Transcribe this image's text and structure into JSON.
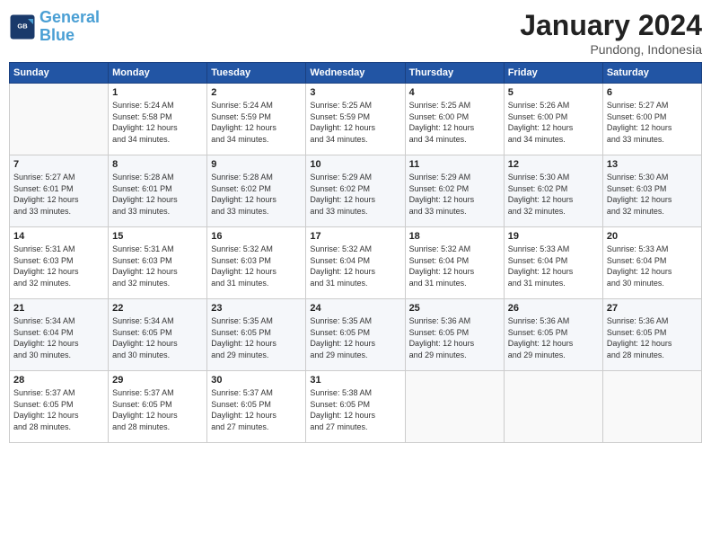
{
  "logo": {
    "text1": "General",
    "text2": "Blue"
  },
  "title": "January 2024",
  "location": "Pundong, Indonesia",
  "headers": [
    "Sunday",
    "Monday",
    "Tuesday",
    "Wednesday",
    "Thursday",
    "Friday",
    "Saturday"
  ],
  "weeks": [
    [
      {
        "day": "",
        "info": ""
      },
      {
        "day": "1",
        "info": "Sunrise: 5:24 AM\nSunset: 5:58 PM\nDaylight: 12 hours\nand 34 minutes."
      },
      {
        "day": "2",
        "info": "Sunrise: 5:24 AM\nSunset: 5:59 PM\nDaylight: 12 hours\nand 34 minutes."
      },
      {
        "day": "3",
        "info": "Sunrise: 5:25 AM\nSunset: 5:59 PM\nDaylight: 12 hours\nand 34 minutes."
      },
      {
        "day": "4",
        "info": "Sunrise: 5:25 AM\nSunset: 6:00 PM\nDaylight: 12 hours\nand 34 minutes."
      },
      {
        "day": "5",
        "info": "Sunrise: 5:26 AM\nSunset: 6:00 PM\nDaylight: 12 hours\nand 34 minutes."
      },
      {
        "day": "6",
        "info": "Sunrise: 5:27 AM\nSunset: 6:00 PM\nDaylight: 12 hours\nand 33 minutes."
      }
    ],
    [
      {
        "day": "7",
        "info": "Sunrise: 5:27 AM\nSunset: 6:01 PM\nDaylight: 12 hours\nand 33 minutes."
      },
      {
        "day": "8",
        "info": "Sunrise: 5:28 AM\nSunset: 6:01 PM\nDaylight: 12 hours\nand 33 minutes."
      },
      {
        "day": "9",
        "info": "Sunrise: 5:28 AM\nSunset: 6:02 PM\nDaylight: 12 hours\nand 33 minutes."
      },
      {
        "day": "10",
        "info": "Sunrise: 5:29 AM\nSunset: 6:02 PM\nDaylight: 12 hours\nand 33 minutes."
      },
      {
        "day": "11",
        "info": "Sunrise: 5:29 AM\nSunset: 6:02 PM\nDaylight: 12 hours\nand 33 minutes."
      },
      {
        "day": "12",
        "info": "Sunrise: 5:30 AM\nSunset: 6:02 PM\nDaylight: 12 hours\nand 32 minutes."
      },
      {
        "day": "13",
        "info": "Sunrise: 5:30 AM\nSunset: 6:03 PM\nDaylight: 12 hours\nand 32 minutes."
      }
    ],
    [
      {
        "day": "14",
        "info": "Sunrise: 5:31 AM\nSunset: 6:03 PM\nDaylight: 12 hours\nand 32 minutes."
      },
      {
        "day": "15",
        "info": "Sunrise: 5:31 AM\nSunset: 6:03 PM\nDaylight: 12 hours\nand 32 minutes."
      },
      {
        "day": "16",
        "info": "Sunrise: 5:32 AM\nSunset: 6:03 PM\nDaylight: 12 hours\nand 31 minutes."
      },
      {
        "day": "17",
        "info": "Sunrise: 5:32 AM\nSunset: 6:04 PM\nDaylight: 12 hours\nand 31 minutes."
      },
      {
        "day": "18",
        "info": "Sunrise: 5:32 AM\nSunset: 6:04 PM\nDaylight: 12 hours\nand 31 minutes."
      },
      {
        "day": "19",
        "info": "Sunrise: 5:33 AM\nSunset: 6:04 PM\nDaylight: 12 hours\nand 31 minutes."
      },
      {
        "day": "20",
        "info": "Sunrise: 5:33 AM\nSunset: 6:04 PM\nDaylight: 12 hours\nand 30 minutes."
      }
    ],
    [
      {
        "day": "21",
        "info": "Sunrise: 5:34 AM\nSunset: 6:04 PM\nDaylight: 12 hours\nand 30 minutes."
      },
      {
        "day": "22",
        "info": "Sunrise: 5:34 AM\nSunset: 6:05 PM\nDaylight: 12 hours\nand 30 minutes."
      },
      {
        "day": "23",
        "info": "Sunrise: 5:35 AM\nSunset: 6:05 PM\nDaylight: 12 hours\nand 29 minutes."
      },
      {
        "day": "24",
        "info": "Sunrise: 5:35 AM\nSunset: 6:05 PM\nDaylight: 12 hours\nand 29 minutes."
      },
      {
        "day": "25",
        "info": "Sunrise: 5:36 AM\nSunset: 6:05 PM\nDaylight: 12 hours\nand 29 minutes."
      },
      {
        "day": "26",
        "info": "Sunrise: 5:36 AM\nSunset: 6:05 PM\nDaylight: 12 hours\nand 29 minutes."
      },
      {
        "day": "27",
        "info": "Sunrise: 5:36 AM\nSunset: 6:05 PM\nDaylight: 12 hours\nand 28 minutes."
      }
    ],
    [
      {
        "day": "28",
        "info": "Sunrise: 5:37 AM\nSunset: 6:05 PM\nDaylight: 12 hours\nand 28 minutes."
      },
      {
        "day": "29",
        "info": "Sunrise: 5:37 AM\nSunset: 6:05 PM\nDaylight: 12 hours\nand 28 minutes."
      },
      {
        "day": "30",
        "info": "Sunrise: 5:37 AM\nSunset: 6:05 PM\nDaylight: 12 hours\nand 27 minutes."
      },
      {
        "day": "31",
        "info": "Sunrise: 5:38 AM\nSunset: 6:05 PM\nDaylight: 12 hours\nand 27 minutes."
      },
      {
        "day": "",
        "info": ""
      },
      {
        "day": "",
        "info": ""
      },
      {
        "day": "",
        "info": ""
      }
    ]
  ]
}
